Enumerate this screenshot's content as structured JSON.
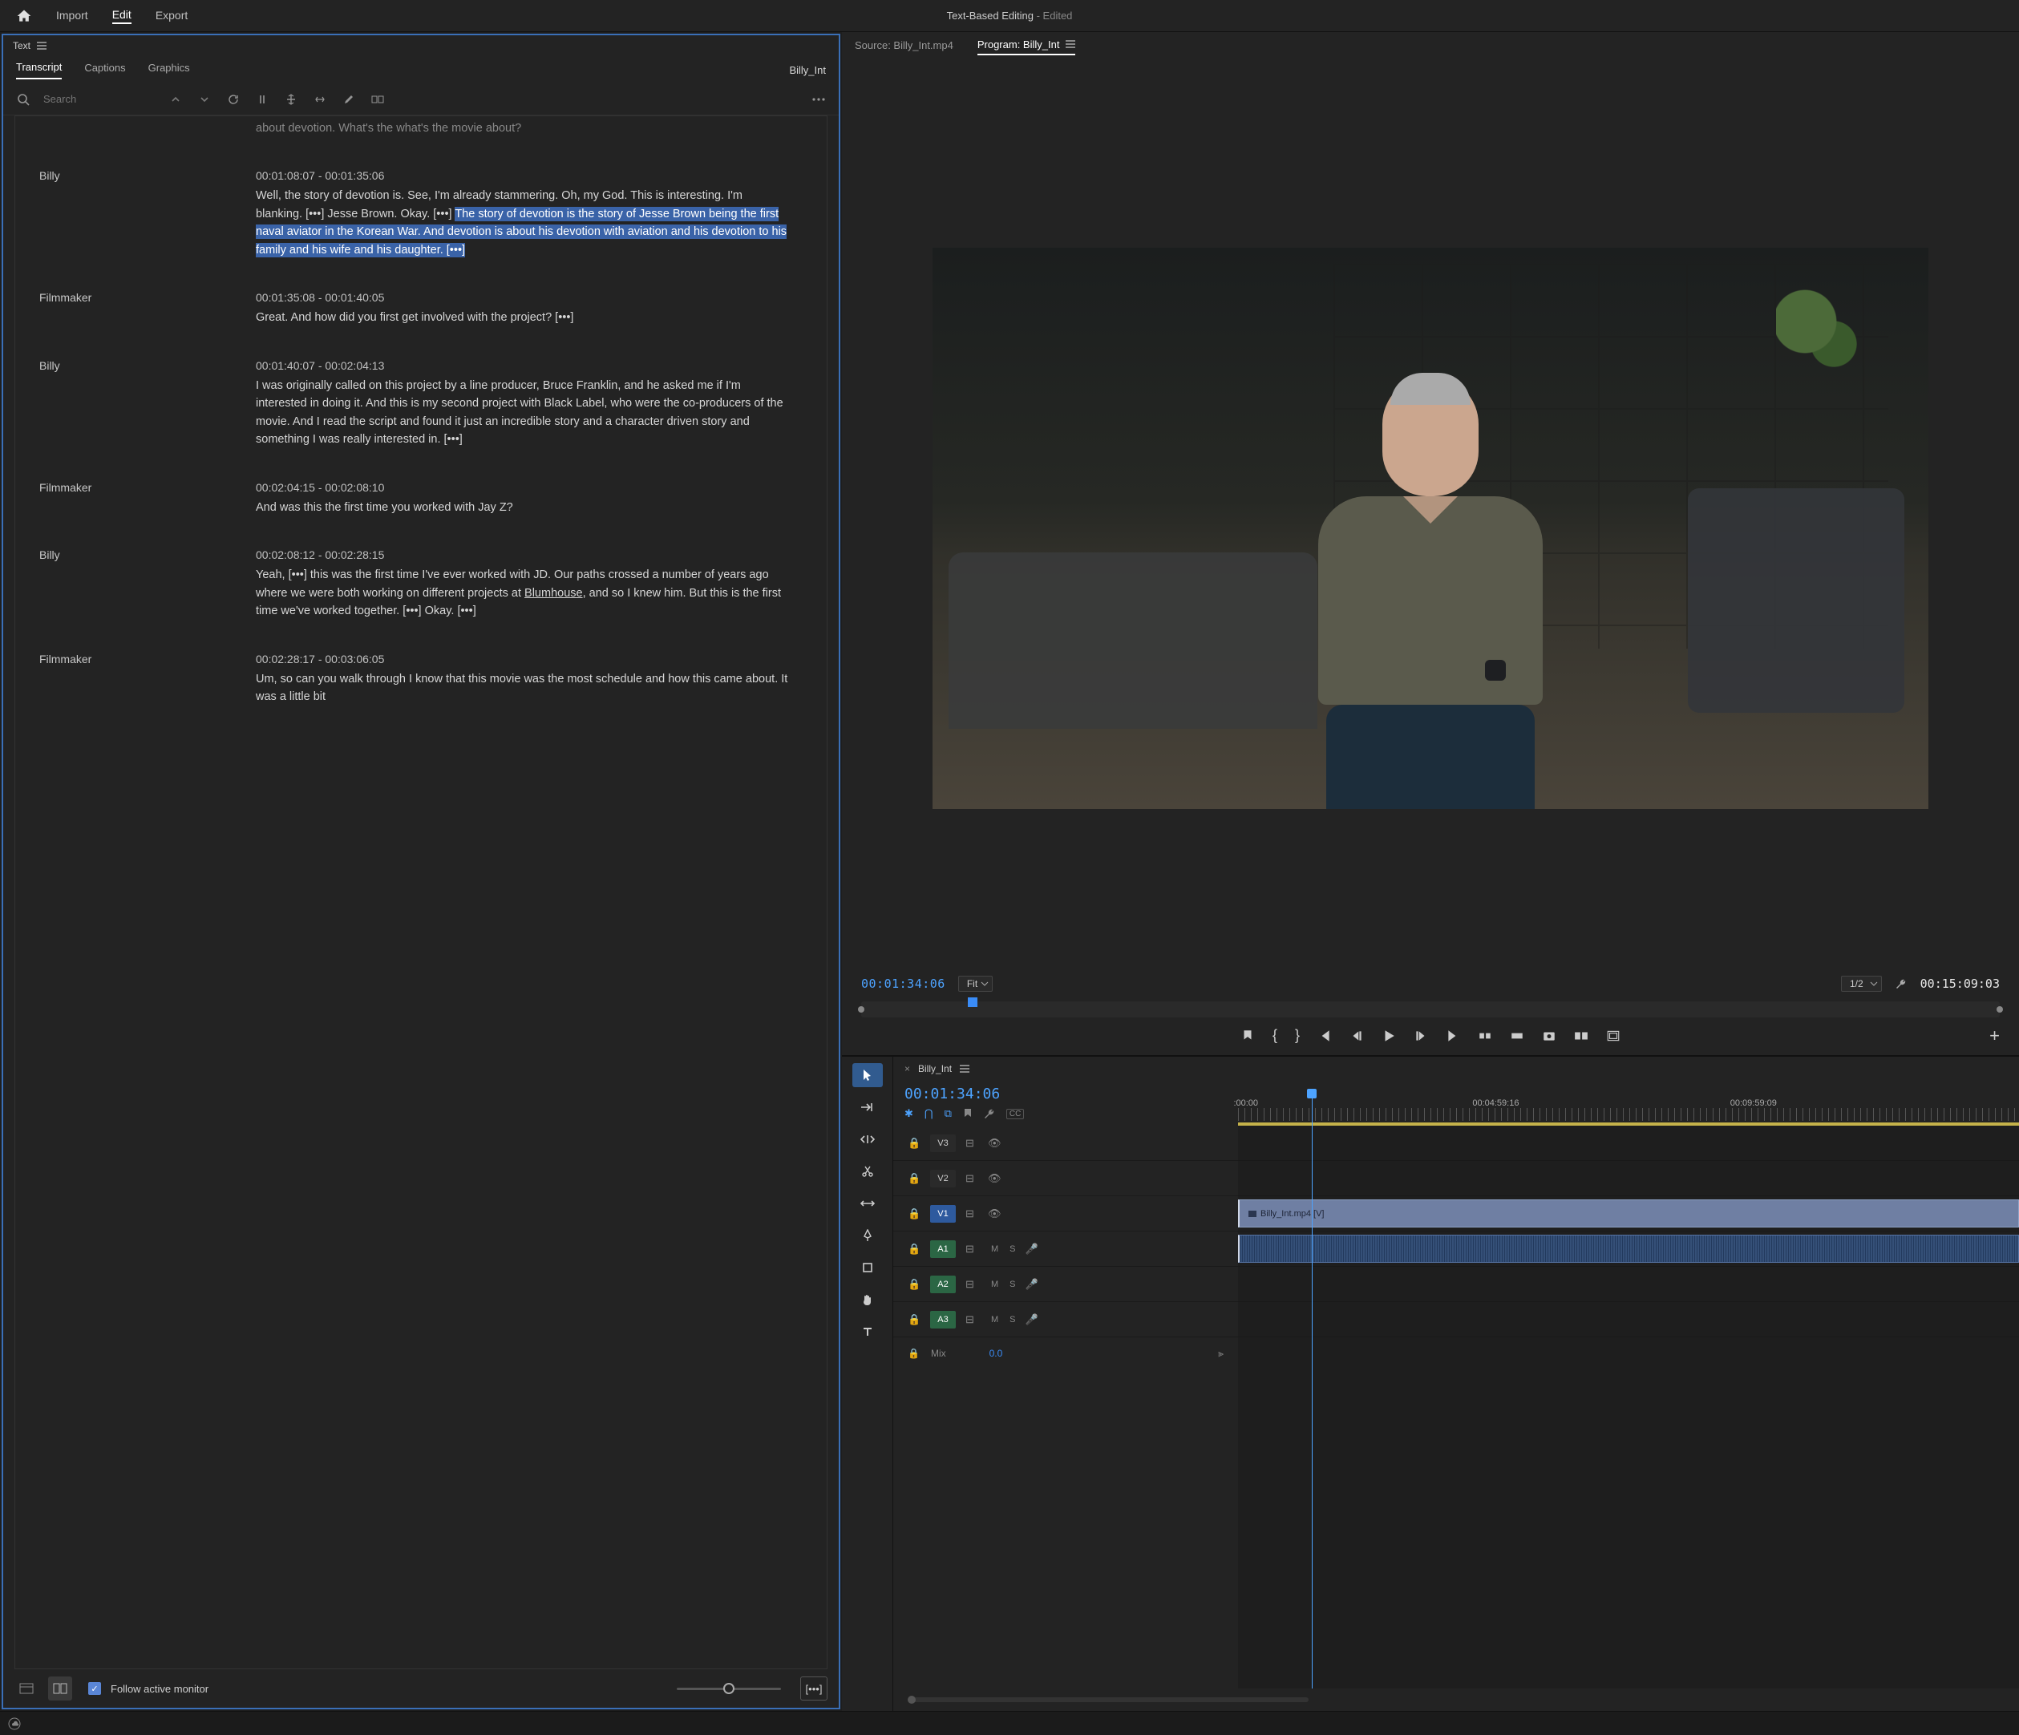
{
  "app": {
    "title": "Text-Based Editing",
    "edited_suffix": " - Edited"
  },
  "workspaces": [
    "Import",
    "Edit",
    "Export"
  ],
  "active_workspace": "Edit",
  "text_panel": {
    "panel_name": "Text",
    "tabs": [
      "Transcript",
      "Captions",
      "Graphics"
    ],
    "active_tab": "Transcript",
    "clip_name": "Billy_Int",
    "search_placeholder": "Search",
    "follow_label": "Follow active monitor",
    "pause_dots": "[•••]"
  },
  "transcript": [
    {
      "speaker": "",
      "time": "",
      "text": "about devotion. What's the what's the movie about?",
      "partial_top": true
    },
    {
      "speaker": "Billy",
      "time": "00:01:08:07 - 00:01:35:06",
      "pre": "Well, the story of devotion is. See, I'm already stammering. Oh, my God. This is interesting. I'm blanking. [•••] Jesse Brown. Okay. [•••] ",
      "hl": "The story of devotion is the story of Jesse Brown being the first naval aviator in the Korean War. And devotion is about his devotion with aviation and his devotion to his family and his wife and his daughter. ",
      "post": "[•••]"
    },
    {
      "speaker": "Filmmaker",
      "time": "00:01:35:08 - 00:01:40:05",
      "text": "Great. And how did you first get involved with the project? [•••]"
    },
    {
      "speaker": "Billy",
      "time": "00:01:40:07 - 00:02:04:13",
      "text": "I was originally called on this project by a line producer, Bruce Franklin, and he asked me if I'm interested in doing it. And this is my second project with Black Label, who were the co-producers of the movie. And I read the script and found it just an incredible story and a character driven story and something I was really interested in. [•••]"
    },
    {
      "speaker": "Filmmaker",
      "time": "00:02:04:15 - 00:02:08:10",
      "text": "And was this the first time you worked with Jay Z?"
    },
    {
      "speaker": "Billy",
      "time": "00:02:08:12 - 00:02:28:15",
      "pre": "Yeah, [•••] this was the first time I've ever worked with JD. Our paths crossed a number of years ago where we were both working on different projects at ",
      "linktext": "Blumhouse",
      "post": ", and so I knew him. But this is the first time we've worked together. [•••] Okay. [•••]"
    },
    {
      "speaker": "Filmmaker",
      "time": "00:02:28:17 - 00:03:06:05",
      "text": "Um, so can you walk through I know that this movie was the most schedule and how this came about. It was a little bit"
    }
  ],
  "source_tab": "Source: Billy_Int.mp4",
  "program_tab": "Program: Billy_Int",
  "program": {
    "tc": "00:01:34:06",
    "fit": "Fit",
    "resolution": "1/2",
    "duration": "00:15:09:03"
  },
  "timeline": {
    "seq_name": "Billy_Int",
    "tc": "00:01:34:06",
    "ruler": [
      {
        "label": ":00:00",
        "pct": 0
      },
      {
        "label": "00:04:59:16",
        "pct": 33
      },
      {
        "label": "00:09:59:09",
        "pct": 66
      }
    ],
    "playhead_pct": 9.4,
    "tracks_v": [
      "V3",
      "V2",
      "V1"
    ],
    "tracks_a": [
      "A1",
      "A2",
      "A3"
    ],
    "clip_v1_label": "Billy_Int.mp4 [V]",
    "mix_label": "Mix",
    "mix_value": "0.0"
  }
}
